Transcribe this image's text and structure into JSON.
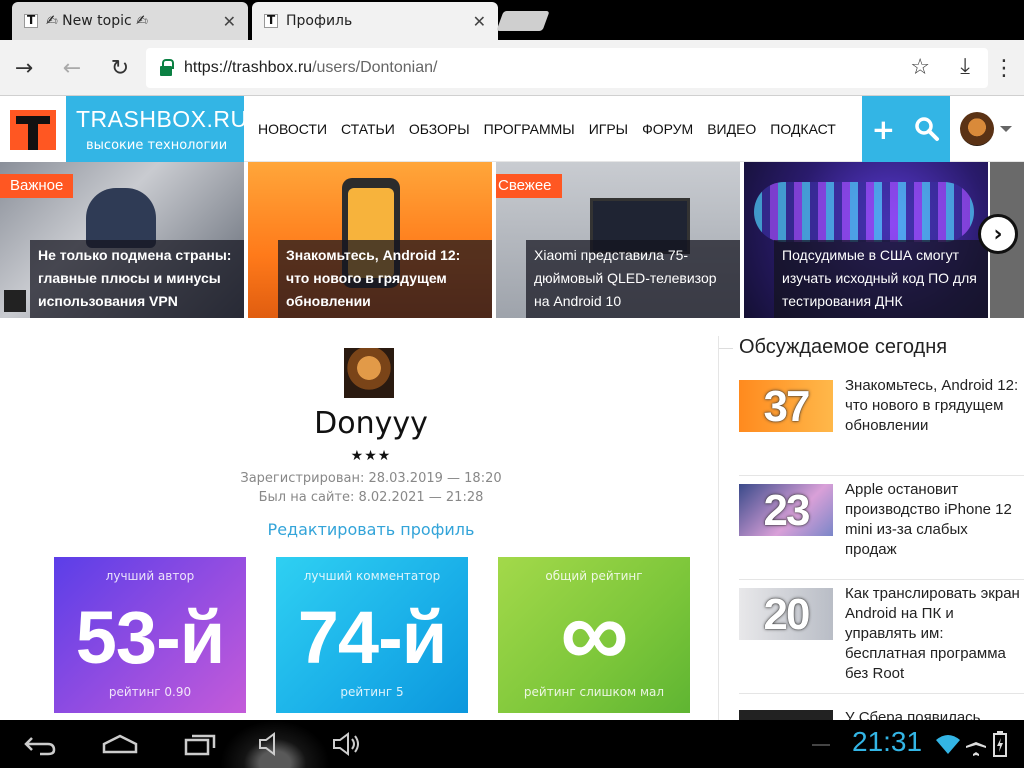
{
  "browser": {
    "tabs": [
      {
        "title": "✍ New topic ✍",
        "active": false
      },
      {
        "title": "Профиль",
        "active": true
      }
    ],
    "url_host": "https://trashbox.ru",
    "url_path": "/users/Dontonian/"
  },
  "site": {
    "brand_name": "TRASHBOX.RU",
    "slogan": "высокие технологии",
    "nav": [
      "НОВОСТИ",
      "СТАТЬИ",
      "ОБЗОРЫ",
      "ПРОГРАММЫ",
      "ИГРЫ",
      "ФОРУМ",
      "ВИДЕО",
      "ПОДКАСТ"
    ],
    "colors": {
      "accent": "#33b5e5",
      "badge": "#ff5722"
    }
  },
  "news_strip": [
    {
      "badge": "Важное",
      "caption": "Не только подмена страны: главные плюсы и минусы использования VPN"
    },
    {
      "badge": "",
      "caption": "Знакомьтесь, Android 12: что нового в грядущем обновлении"
    },
    {
      "badge": "Свежее",
      "caption": "Xiaomi представила 75-дюймовый QLED-телевизор на Android 10"
    },
    {
      "badge": "",
      "caption": "Подсудимые в США смогут изучать исходный код ПО для тестирования ДНК"
    }
  ],
  "profile": {
    "name": "Donyyy",
    "stars": "★★★",
    "registered": "Зарегистрирован: 28.03.2019 — 18:20",
    "last_seen": "Был на сайте: 8.02.2021 — 21:28",
    "edit_link": "Редактировать профиль",
    "stats": [
      {
        "label": "лучший автор",
        "value": "53-й",
        "sub": "рейтинг 0.90"
      },
      {
        "label": "лучший комментатор",
        "value": "74-й",
        "sub": "рейтинг 5"
      },
      {
        "label": "общий рейтинг",
        "value": "∞",
        "sub": "рейтинг слишком мал"
      }
    ]
  },
  "sidebar": {
    "title": "Обсуждаемое сегодня",
    "items": [
      {
        "count": "37",
        "text": "Знакомьтесь, Android 12: что нового в грядущем обновлении"
      },
      {
        "count": "23",
        "text": "Apple остановит производство iPhone 12 mini из-за слабых продаж"
      },
      {
        "count": "20",
        "text": "Как транслировать экран Android на ПК и управлять им: бесплатная программа без Root"
      },
      {
        "count": "",
        "text": "У Сбера появилась"
      }
    ]
  },
  "system": {
    "clock": "21:31"
  }
}
